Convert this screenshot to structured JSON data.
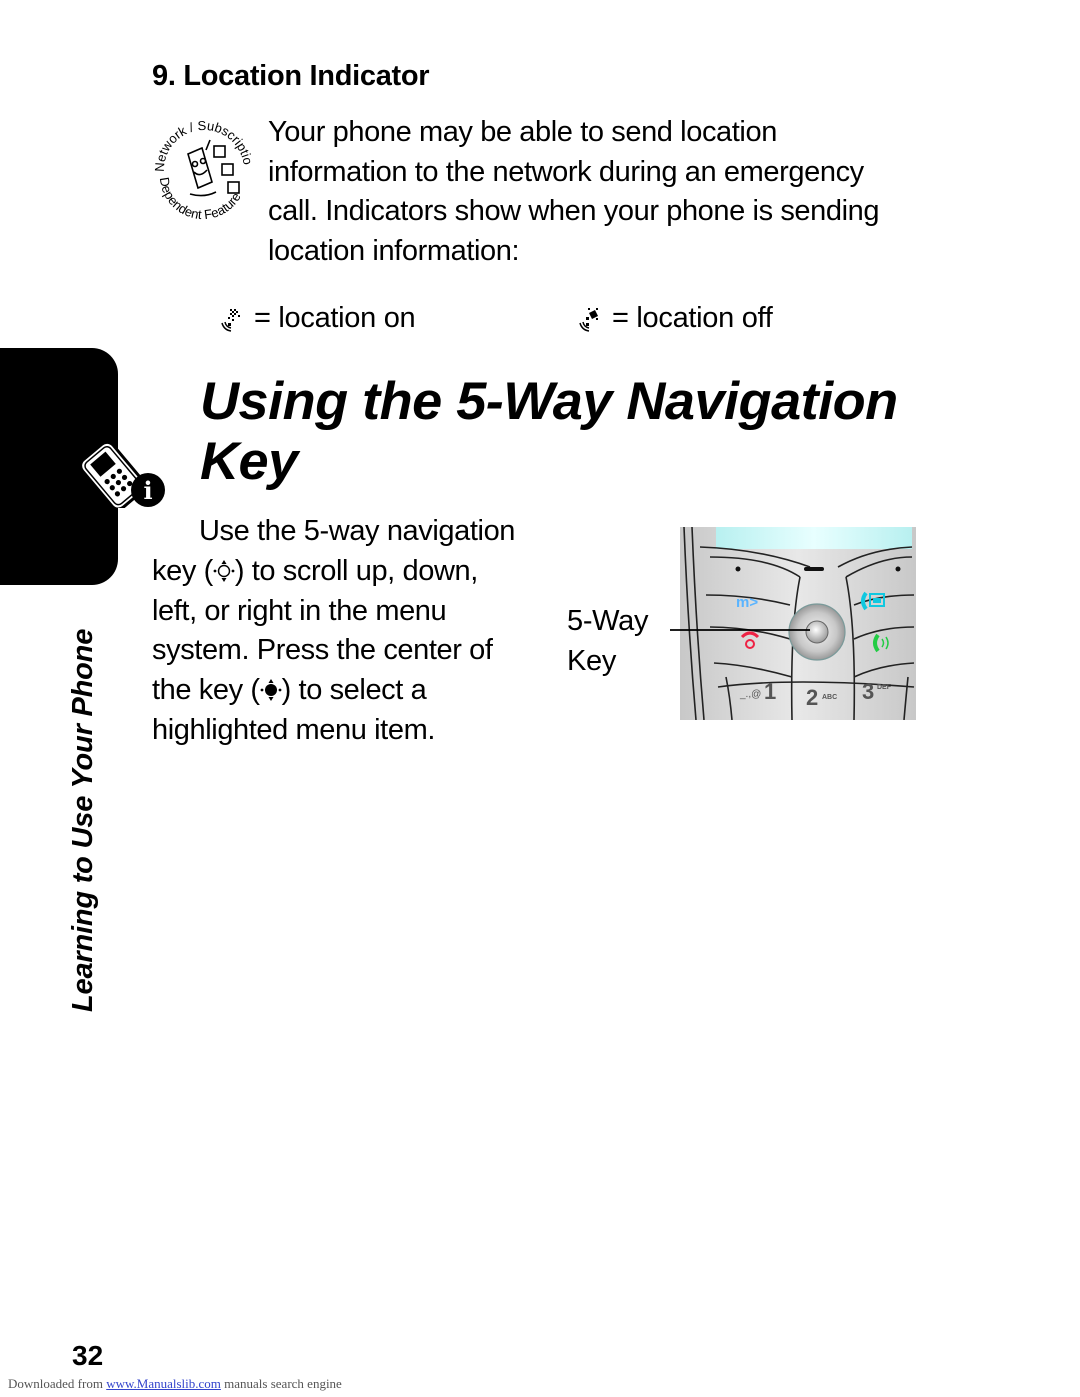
{
  "location_section": {
    "heading": "9. Location Indicator",
    "badge": {
      "top_text": "Network / Subscription",
      "bottom_text": "Dependent Feature",
      "icon": "network-subscription-dependent-feature-icon"
    },
    "intro_lines": [
      "Your phone may be able to send location",
      "information to the network during an emergency",
      "call. Indicators show when your phone is sending",
      "location information:"
    ],
    "legend": [
      {
        "icon": "location-on-icon",
        "label": "= location on"
      },
      {
        "icon": "location-off-icon",
        "label": "= location off"
      }
    ]
  },
  "nav_section": {
    "title_line1": "Using the 5-Way Navigation",
    "title_line2": "Key",
    "tab_icon": "phone-info-icon",
    "body": {
      "line1": "Use the 5-way navigation",
      "line2_pre": "key (",
      "line2_post": ") to scroll up, down,",
      "line3": "left, or right in the menu",
      "line4": "system. Press the center of",
      "line5_pre": "the key (",
      "line5_post": ") to select a",
      "line6": "highlighted menu item."
    },
    "callout": {
      "line1": "5-Way",
      "line2": "Key"
    },
    "phone_keys": {
      "menu": "m>",
      "key1": "1",
      "key1_sub": "_.,@",
      "key2": "2",
      "key2_sub": "ABC",
      "key3": "3",
      "key3_sub": "DEF"
    }
  },
  "side_caption": "Learning to Use Your Phone",
  "page_number": "32",
  "footer": {
    "prefix": "Downloaded from ",
    "link_text": "www.Manualslib.com",
    "suffix": " manuals search engine"
  }
}
